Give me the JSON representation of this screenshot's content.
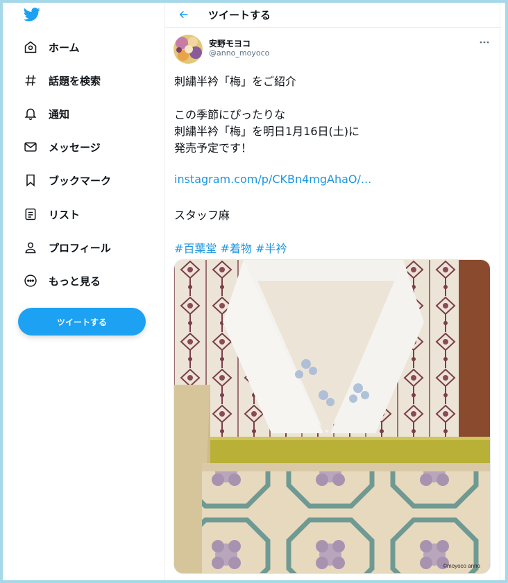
{
  "sidebar": {
    "logo_icon": "twitter-bird-icon",
    "items": [
      {
        "label": "ホーム",
        "icon": "home-icon"
      },
      {
        "label": "話題を検索",
        "icon": "hashtag-icon"
      },
      {
        "label": "通知",
        "icon": "bell-icon"
      },
      {
        "label": "メッセージ",
        "icon": "envelope-icon"
      },
      {
        "label": "ブックマーク",
        "icon": "bookmark-icon"
      },
      {
        "label": "リスト",
        "icon": "list-icon"
      },
      {
        "label": "プロフィール",
        "icon": "person-icon"
      },
      {
        "label": "もっと見る",
        "icon": "more-circle-icon"
      }
    ],
    "tweet_button": "ツイートする"
  },
  "header": {
    "title": "ツイートする",
    "back_icon": "arrow-left-icon"
  },
  "tweet": {
    "author_name": "安野モヨコ",
    "author_handle": "@anno_moyoco",
    "lines": {
      "l1": "刺繍半衿「梅」をご紹介",
      "l2": "この季節にぴったりな",
      "l3": "刺繍半衿「梅」を明日1月16日(土)に",
      "l4": "発売予定です！",
      "link": "instagram.com/p/CKBn4mgAhaO/...",
      "staff": "スタッフ麻",
      "tag1": "#百葉堂",
      "tag2": "#着物",
      "tag3": "#半衿"
    },
    "image_watermark": "©moyoco anno"
  },
  "colors": {
    "accent": "#1da1f2",
    "link": "#1b95e0",
    "frame": "#a6d8ea"
  }
}
